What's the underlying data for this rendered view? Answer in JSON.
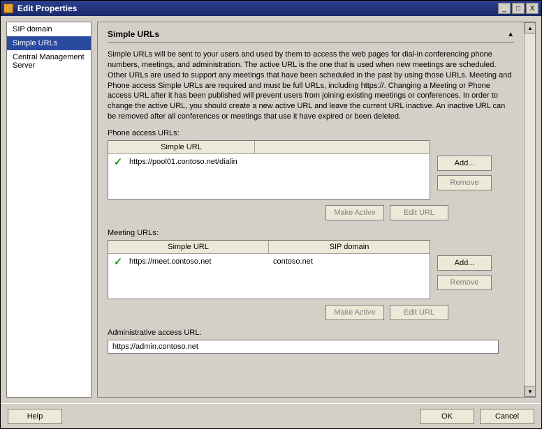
{
  "window": {
    "title": "Edit Properties",
    "buttons": {
      "min": "_",
      "max": "□",
      "close": "X"
    }
  },
  "nav": {
    "items": [
      {
        "label": "SIP domain",
        "selected": false
      },
      {
        "label": "Simple URLs",
        "selected": true
      },
      {
        "label": "Central Management Server",
        "selected": false
      }
    ]
  },
  "section": {
    "title": "Simple URLs",
    "description": "Simple URLs will be sent to your users and used by them to access the web pages for dial-in conferencing phone numbers, meetings, and administration. The active URL is the one that is used when new meetings are scheduled. Other URLs are used to support any meetings that have been scheduled in the past by using those URLs. Meeting and Phone access Simple URLs are required and must be full URLs, including https://. Changing a Meeting or Phone access URL after it has been published will prevent users from joining existing meetings or conferences. In order to change the active URL, you should create a new active URL and leave the current URL inactive. An inactive URL can be removed after all conferences or meetings that use it have expired or been deleted."
  },
  "phone": {
    "label": "Phone access URLs:",
    "columns": {
      "c1": "Simple URL"
    },
    "rows": [
      {
        "active": true,
        "url": "https://pool01.contoso.net/dialin"
      }
    ],
    "buttons": {
      "add": "Add...",
      "remove": "Remove",
      "makeActive": "Make Active",
      "edit": "Edit URL"
    }
  },
  "meeting": {
    "label": "Meeting URLs:",
    "columns": {
      "c1": "Simple URL",
      "c2": "SIP domain"
    },
    "rows": [
      {
        "active": true,
        "url": "https://meet.contoso.net",
        "domain": "contoso.net"
      }
    ],
    "buttons": {
      "add": "Add...",
      "remove": "Remove",
      "makeActive": "Make Active",
      "edit": "Edit URL"
    }
  },
  "admin": {
    "label": "Administrative access URL:",
    "value": "https://admin.contoso.net"
  },
  "footer": {
    "help": "Help",
    "ok": "OK",
    "cancel": "Cancel"
  }
}
